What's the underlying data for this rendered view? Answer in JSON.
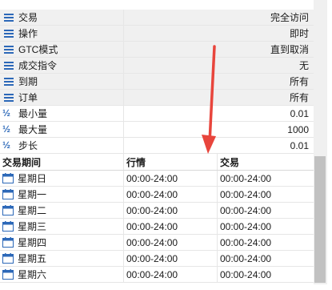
{
  "properties": [
    {
      "name": "交易",
      "value": "完全访问",
      "icon": "list-icon"
    },
    {
      "name": "操作",
      "value": "即时",
      "icon": "list-icon"
    },
    {
      "name": "GTC模式",
      "value": "直到取消",
      "icon": "list-icon"
    },
    {
      "name": "成交指令",
      "value": "无",
      "icon": "list-icon"
    },
    {
      "name": "到期",
      "value": "所有",
      "icon": "list-icon"
    },
    {
      "name": "订单",
      "value": "所有",
      "icon": "list-icon"
    },
    {
      "name": "最小量",
      "value": "0.01",
      "icon": "half-icon"
    },
    {
      "name": "最大量",
      "value": "1000",
      "icon": "half-icon"
    },
    {
      "name": "步长",
      "value": "0.01",
      "icon": "half-icon"
    }
  ],
  "half_symbol": "½",
  "schedule": {
    "headers": [
      "交易期间",
      "行情",
      "交易"
    ],
    "rows": [
      {
        "day": "星期日",
        "quotes": "00:00-24:00",
        "trade": "00:00-24:00"
      },
      {
        "day": "星期一",
        "quotes": "00:00-24:00",
        "trade": "00:00-24:00"
      },
      {
        "day": "星期二",
        "quotes": "00:00-24:00",
        "trade": "00:00-24:00"
      },
      {
        "day": "星期三",
        "quotes": "00:00-24:00",
        "trade": "00:00-24:00"
      },
      {
        "day": "星期四",
        "quotes": "00:00-24:00",
        "trade": "00:00-24:00"
      },
      {
        "day": "星期五",
        "quotes": "00:00-24:00",
        "trade": "00:00-24:00"
      },
      {
        "day": "星期六",
        "quotes": "00:00-24:00",
        "trade": "00:00-24:00"
      }
    ]
  },
  "colors": {
    "annotation_arrow": "#e8453c",
    "icon_blue": "#2c68b8"
  }
}
